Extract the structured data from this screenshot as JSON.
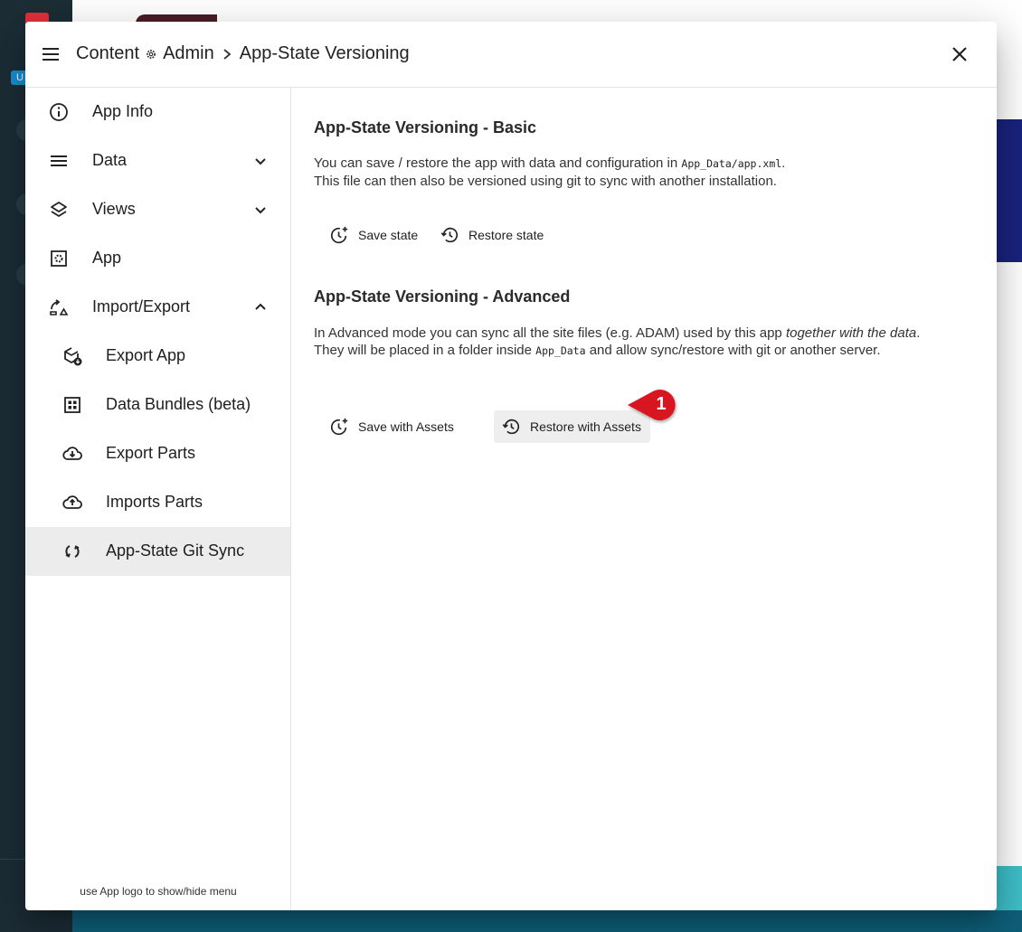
{
  "background": {
    "badge": "U"
  },
  "header": {
    "breadcrumb": {
      "content": "Content",
      "admin": "Admin",
      "page": "App-State Versioning"
    }
  },
  "sidebar": {
    "items": [
      {
        "label": "App Info",
        "icon": "info-icon"
      },
      {
        "label": "Data",
        "icon": "list-icon",
        "expand": "chevron-down"
      },
      {
        "label": "Views",
        "icon": "layers-icon",
        "expand": "chevron-down"
      },
      {
        "label": "App",
        "icon": "app-settings-icon"
      },
      {
        "label": "Import/Export",
        "icon": "import-export-icon",
        "expand": "chevron-up"
      },
      {
        "label": "Export App",
        "icon": "package-download-icon"
      },
      {
        "label": "Data Bundles (beta)",
        "icon": "grid-icon"
      },
      {
        "label": "Export Parts",
        "icon": "cloud-download-icon"
      },
      {
        "label": "Imports Parts",
        "icon": "cloud-upload-icon"
      },
      {
        "label": "App-State Git Sync",
        "icon": "sync-icon",
        "active": true
      }
    ],
    "hint": "use App logo to show/hide menu"
  },
  "content": {
    "basic": {
      "title": "App-State Versioning - Basic",
      "text1": "You can save / restore the app with data and configuration in ",
      "code1": "App_Data/app.xml",
      "text1_end": ".",
      "text2": "This file can then also be versioned using git to sync with another installation.",
      "save_label": "Save state",
      "restore_label": "Restore state"
    },
    "advanced": {
      "title": "App-State Versioning - Advanced",
      "text1": "In Advanced mode you can sync all the site files (e.g. ADAM) used by this app ",
      "text1_italic": "together with the data",
      "text1_end": ".",
      "text2_start": "They will be placed in a folder inside ",
      "code2": "App_Data",
      "text2_end": " and allow sync/restore with git or another server.",
      "save_label": "Save with Assets",
      "restore_label": "Restore with Assets"
    }
  },
  "callout": {
    "number": "1",
    "color": "#d71920"
  }
}
